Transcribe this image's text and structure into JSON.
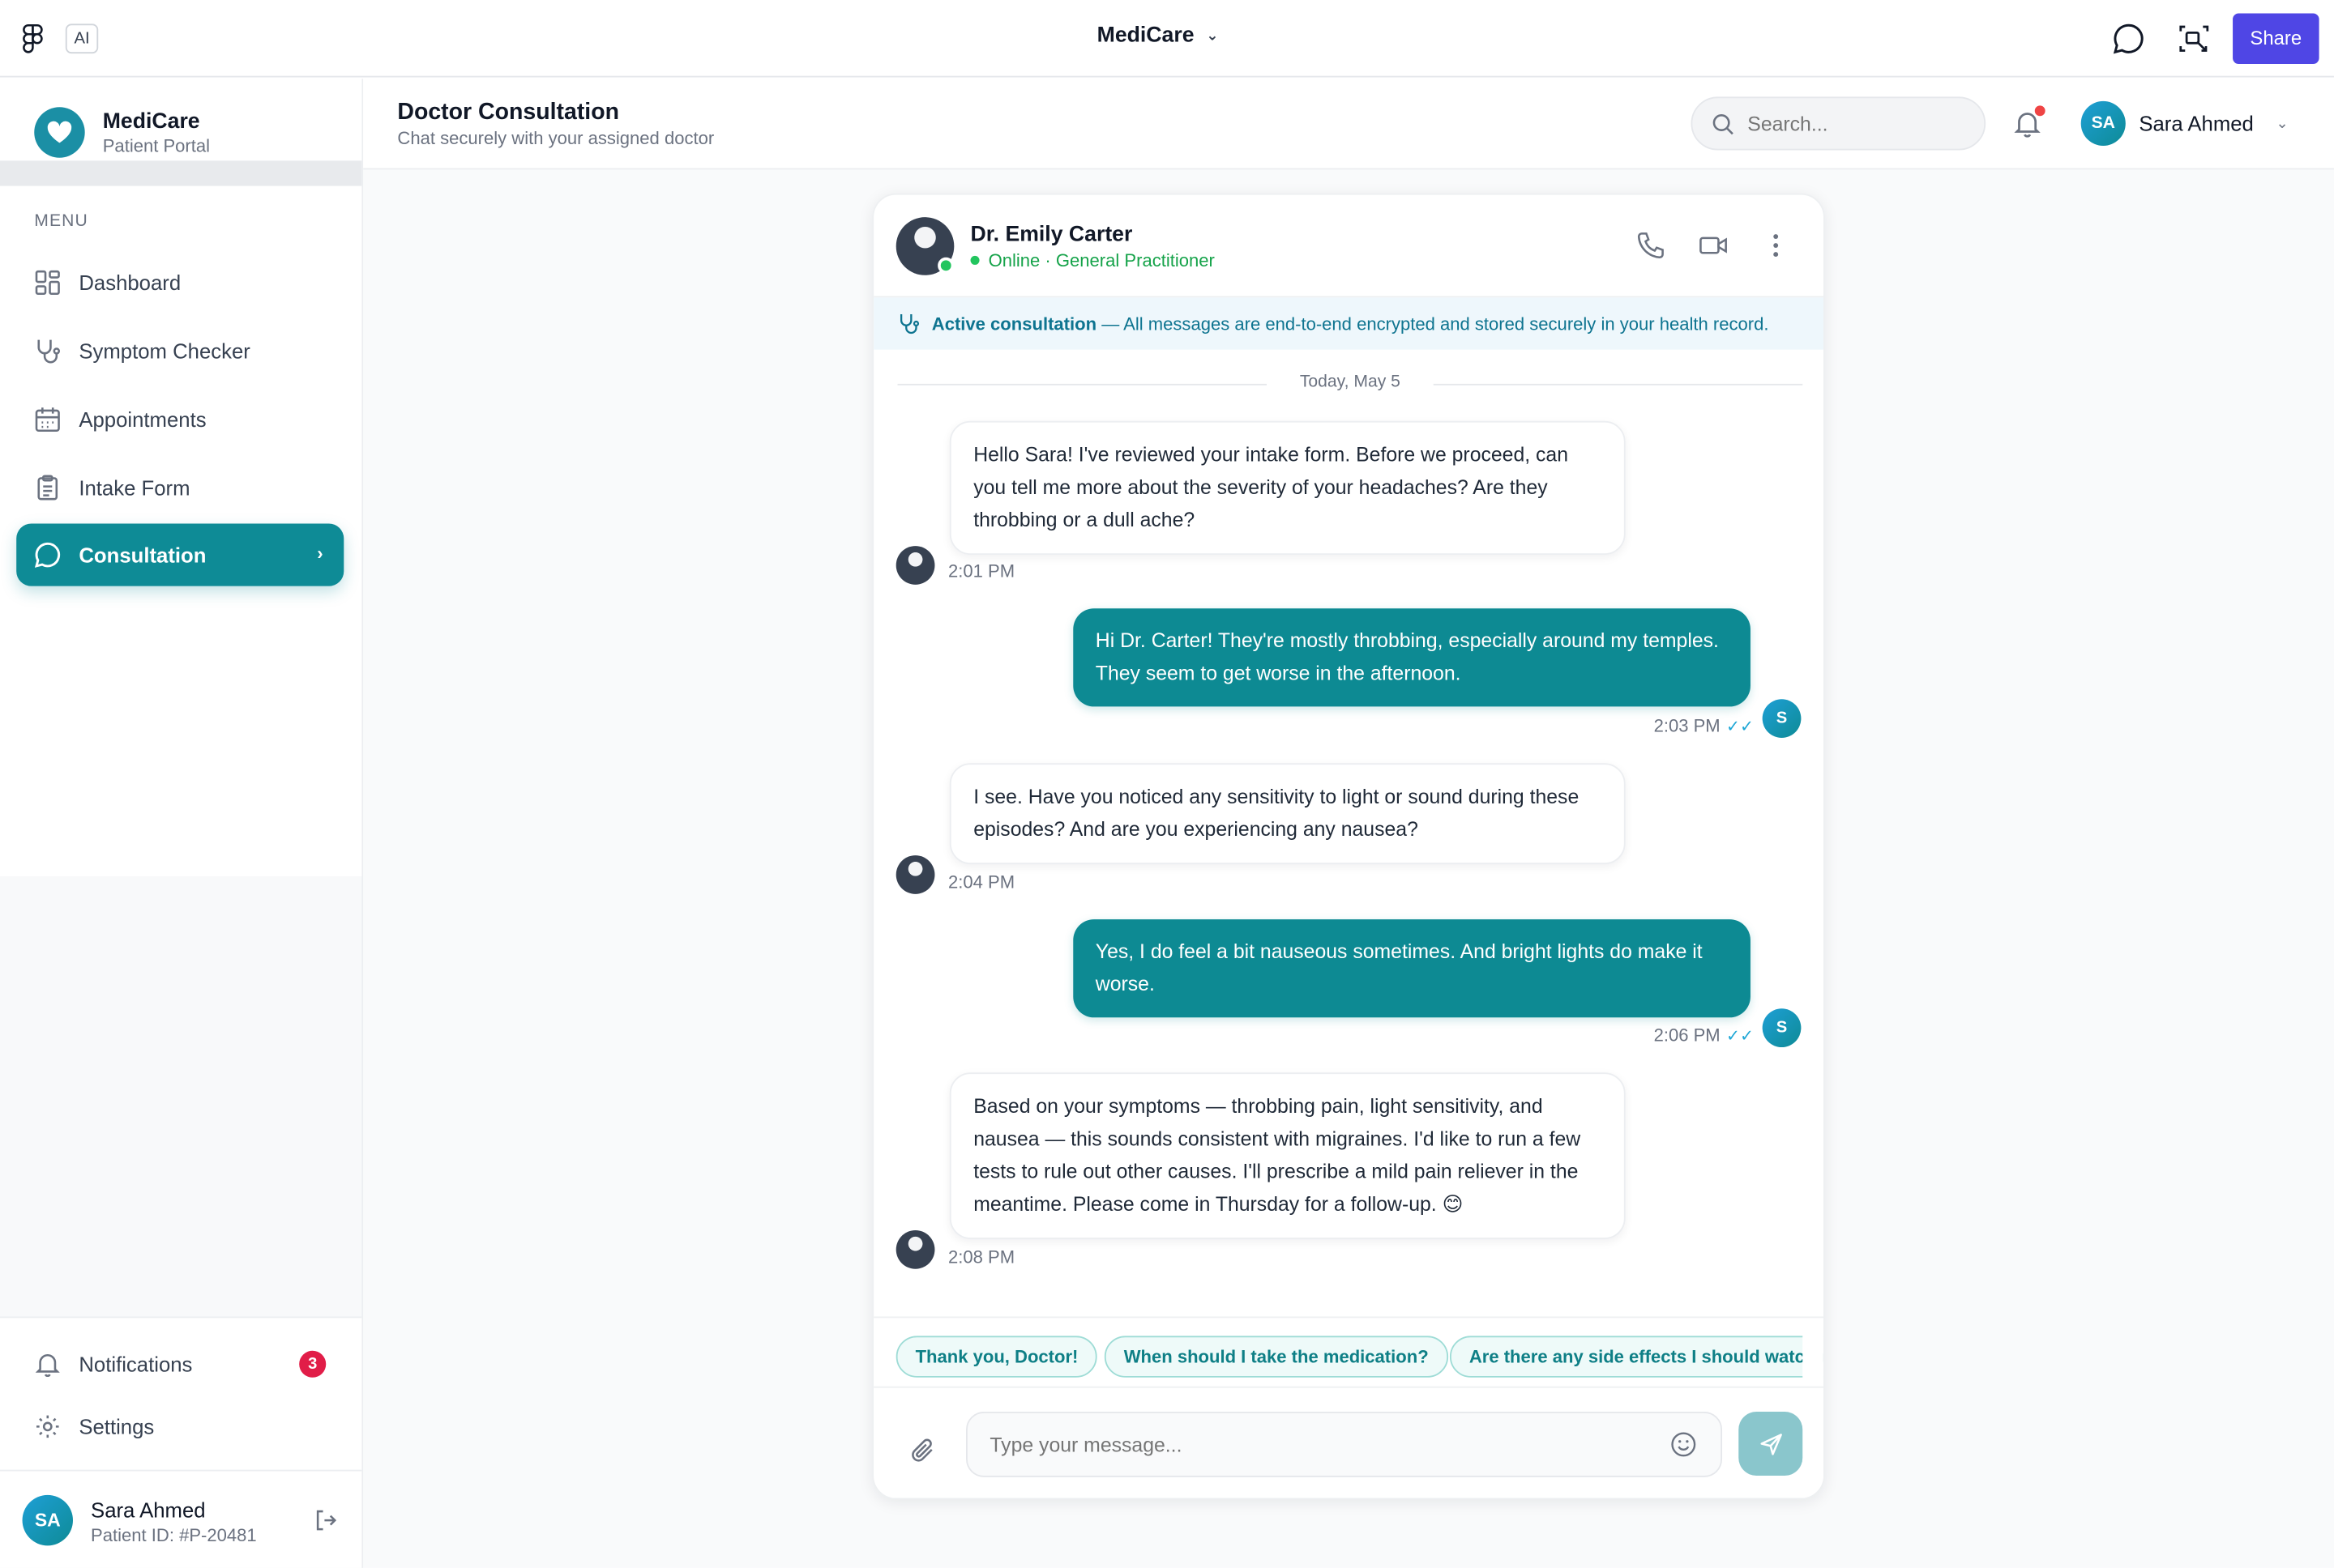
{
  "chrome": {
    "ai_label": "AI",
    "app_title": "MediCare",
    "share_label": "Share"
  },
  "sidebar": {
    "brand_name": "MediCare",
    "brand_sub": "Patient Portal",
    "menu_label": "MENU",
    "items": [
      {
        "label": "Dashboard",
        "icon": "grid-icon"
      },
      {
        "label": "Symptom Checker",
        "icon": "stethoscope-icon"
      },
      {
        "label": "Appointments",
        "icon": "calendar-icon"
      },
      {
        "label": "Intake Form",
        "icon": "clipboard-icon"
      },
      {
        "label": "Consultation",
        "icon": "chat-bubble-icon",
        "active": true
      }
    ],
    "bottom_items": [
      {
        "label": "Notifications",
        "icon": "bell-icon",
        "badge": "3"
      },
      {
        "label": "Settings",
        "icon": "gear-icon"
      }
    ],
    "user": {
      "initials": "SA",
      "name": "Sara Ahmed",
      "patient_id": "Patient ID: #P-20481"
    }
  },
  "header": {
    "title": "Doctor Consultation",
    "subtitle": "Chat securely with your assigned doctor",
    "search_placeholder": "Search...",
    "user_initials": "SA",
    "user_name": "Sara Ahmed"
  },
  "chat": {
    "doctor_name": "Dr. Emily Carter",
    "doctor_status": "Online · General Practitioner",
    "notice_bold": "Active consultation",
    "notice_rest": "— All messages are end-to-end encrypted and stored securely in your health record.",
    "date_label": "Today, May 5",
    "messages": [
      {
        "from": "doctor",
        "text": "Hello Sara! I've reviewed your intake form. Before we proceed, can you tell me more about the severity of your headaches? Are they throbbing or a dull ache?",
        "time": "2:01 PM"
      },
      {
        "from": "patient",
        "text": "Hi Dr. Carter! They're mostly throbbing, especially around my temples. They seem to get worse in the afternoon.",
        "time": "2:03 PM",
        "initial": "S"
      },
      {
        "from": "doctor",
        "text": "I see. Have you noticed any sensitivity to light or sound during these episodes? And are you experiencing any nausea?",
        "time": "2:04 PM"
      },
      {
        "from": "patient",
        "text": "Yes, I do feel a bit nauseous sometimes. And bright lights do make it worse.",
        "time": "2:06 PM",
        "initial": "S"
      },
      {
        "from": "doctor",
        "text": "Based on your symptoms — throbbing pain, light sensitivity, and nausea — this sounds consistent with migraines. I'd like to run a few tests to rule out other causes. I'll prescribe a mild pain reliever in the meantime. Please come in Thursday for a follow-up. 😊",
        "time": "2:08 PM"
      }
    ],
    "quick_replies": [
      "Thank you, Doctor!",
      "When should I take the medication?",
      "Are there any side effects I should watch out for?"
    ],
    "input_placeholder": "Type your message..."
  },
  "colors": {
    "accent": "#0e8b96",
    "share": "#4f46e5",
    "online": "#22c55e",
    "badge": "#e11d48"
  }
}
